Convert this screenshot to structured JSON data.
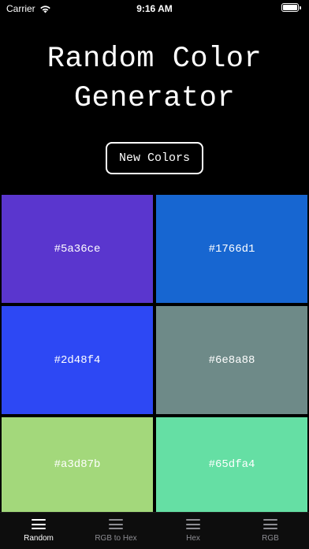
{
  "status_bar": {
    "carrier": "Carrier",
    "time": "9:16 AM",
    "battery_level_percent": 100
  },
  "title": {
    "line1": "Random Color",
    "line2": "Generator"
  },
  "new_colors_button": {
    "label": "New Colors"
  },
  "swatches": [
    {
      "hex": "#5a36ce",
      "label": "#5a36ce"
    },
    {
      "hex": "#1766d1",
      "label": "#1766d1"
    },
    {
      "hex": "#2d48f4",
      "label": "#2d48f4"
    },
    {
      "hex": "#6e8a88",
      "label": "#6e8a88"
    },
    {
      "hex": "#a3d87b",
      "label": "#a3d87b"
    },
    {
      "hex": "#65dfa4",
      "label": "#65dfa4"
    }
  ],
  "tab_bar": {
    "tabs": [
      {
        "label": "Random",
        "icon": "hamburger-icon",
        "active": true
      },
      {
        "label": "RGB to Hex",
        "icon": "hamburger-icon",
        "active": false
      },
      {
        "label": "Hex",
        "icon": "hamburger-icon",
        "active": false
      },
      {
        "label": "RGB",
        "icon": "hamburger-icon",
        "active": false
      }
    ]
  },
  "colors": {
    "background": "#000000",
    "text": "#ffffff",
    "tab_inactive": "#8e8e93"
  }
}
